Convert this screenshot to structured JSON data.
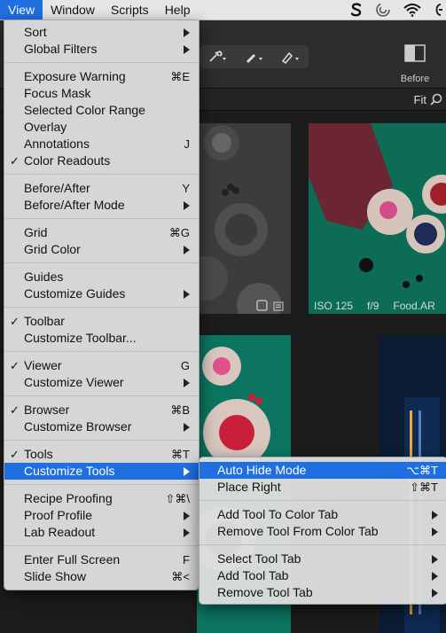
{
  "menubar": {
    "items": [
      "View",
      "Window",
      "Scripts",
      "Help"
    ],
    "active_index": 0,
    "status_icons": [
      "s-app-icon",
      "sync-icon",
      "wifi-icon",
      "battery-icon"
    ]
  },
  "app": {
    "fit_label": "Fit",
    "before_label": "Before",
    "photo_meta": {
      "iso": "ISO 125",
      "aperture": "f/9",
      "filename": "Food.AR"
    }
  },
  "view_menu": {
    "items": [
      {
        "label": "Sort",
        "shortcut": "",
        "submenu": true,
        "checked": false
      },
      {
        "label": "Global Filters",
        "shortcut": "",
        "submenu": true,
        "checked": false
      },
      {
        "label": "Exposure Warning",
        "shortcut": "⌘E",
        "submenu": false,
        "checked": false
      },
      {
        "label": "Focus Mask",
        "shortcut": "",
        "submenu": false,
        "checked": false
      },
      {
        "label": "Selected Color Range",
        "shortcut": "",
        "submenu": false,
        "checked": false
      },
      {
        "label": "Overlay",
        "shortcut": "",
        "submenu": false,
        "checked": false
      },
      {
        "label": "Annotations",
        "shortcut": "J",
        "submenu": false,
        "checked": false
      },
      {
        "label": "Color Readouts",
        "shortcut": "",
        "submenu": false,
        "checked": true
      },
      {
        "label": "Before/After",
        "shortcut": "Y",
        "submenu": false,
        "checked": false
      },
      {
        "label": "Before/After Mode",
        "shortcut": "",
        "submenu": true,
        "checked": false
      },
      {
        "label": "Grid",
        "shortcut": "⌘G",
        "submenu": false,
        "checked": false
      },
      {
        "label": "Grid Color",
        "shortcut": "",
        "submenu": true,
        "checked": false
      },
      {
        "label": "Guides",
        "shortcut": "",
        "submenu": false,
        "checked": false
      },
      {
        "label": "Customize Guides",
        "shortcut": "",
        "submenu": true,
        "checked": false
      },
      {
        "label": "Toolbar",
        "shortcut": "",
        "submenu": false,
        "checked": true
      },
      {
        "label": "Customize Toolbar...",
        "shortcut": "",
        "submenu": false,
        "checked": false
      },
      {
        "label": "Viewer",
        "shortcut": "G",
        "submenu": false,
        "checked": true
      },
      {
        "label": "Customize Viewer",
        "shortcut": "",
        "submenu": true,
        "checked": false
      },
      {
        "label": "Browser",
        "shortcut": "⌘B",
        "submenu": false,
        "checked": true
      },
      {
        "label": "Customize Browser",
        "shortcut": "",
        "submenu": true,
        "checked": false
      },
      {
        "label": "Tools",
        "shortcut": "⌘T",
        "submenu": false,
        "checked": true
      },
      {
        "label": "Customize Tools",
        "shortcut": "",
        "submenu": true,
        "checked": false,
        "highlighted": true
      },
      {
        "label": "Recipe Proofing",
        "shortcut": "⇧⌘\\",
        "submenu": false,
        "checked": false
      },
      {
        "label": "Proof Profile",
        "shortcut": "",
        "submenu": true,
        "checked": false
      },
      {
        "label": "Lab Readout",
        "shortcut": "",
        "submenu": true,
        "checked": false
      },
      {
        "label": "Enter Full Screen",
        "shortcut": "F",
        "submenu": false,
        "checked": false
      },
      {
        "label": "Slide Show",
        "shortcut": "⌘<",
        "submenu": false,
        "checked": false
      }
    ]
  },
  "customize_tools_menu": {
    "items": [
      {
        "label": "Auto Hide Mode",
        "shortcut": "⌥⌘T",
        "submenu": false,
        "highlighted": true
      },
      {
        "label": "Place Right",
        "shortcut": "⇧⌘T",
        "submenu": false
      },
      {
        "label": "Add Tool To Color Tab",
        "shortcut": "",
        "submenu": true
      },
      {
        "label": "Remove Tool From Color Tab",
        "shortcut": "",
        "submenu": true
      },
      {
        "label": "Select Tool Tab",
        "shortcut": "",
        "submenu": true
      },
      {
        "label": "Add Tool Tab",
        "shortcut": "",
        "submenu": true
      },
      {
        "label": "Remove Tool Tab",
        "shortcut": "",
        "submenu": true
      }
    ]
  }
}
